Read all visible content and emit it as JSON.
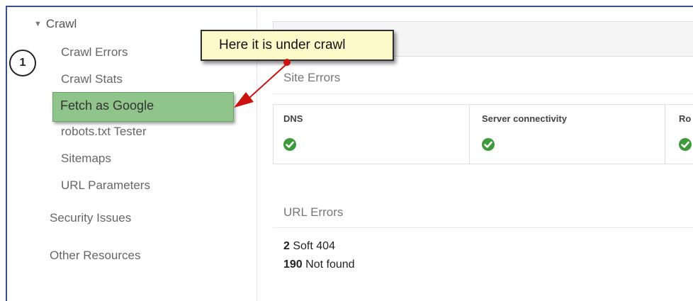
{
  "sidebar": {
    "crawl_label": "Crawl",
    "items": [
      {
        "label": "Crawl Errors"
      },
      {
        "label": "Crawl Stats"
      },
      {
        "label": "Fetch as Google"
      },
      {
        "label": "robots.txt Tester"
      },
      {
        "label": "Sitemaps"
      },
      {
        "label": "URL Parameters"
      }
    ],
    "sections": [
      {
        "label": "Security Issues"
      },
      {
        "label": "Other Resources"
      }
    ]
  },
  "annotation": {
    "step_number": "1",
    "callout_text": "Here it is under crawl"
  },
  "main": {
    "site_errors_title": "Site Errors",
    "status_cells": [
      {
        "label": "DNS"
      },
      {
        "label": "Server connectivity"
      },
      {
        "label": "Ro"
      }
    ],
    "url_errors_title": "URL Errors",
    "errors": [
      {
        "count": "2",
        "text": "Soft 404"
      },
      {
        "count": "190",
        "text": "Not found"
      }
    ]
  },
  "colors": {
    "highlight": "#8fc48a",
    "callout_bg": "#fdf9c9",
    "arrow": "#cc1111",
    "check": "#3d9b3b",
    "frame": "#3a4f8f"
  }
}
